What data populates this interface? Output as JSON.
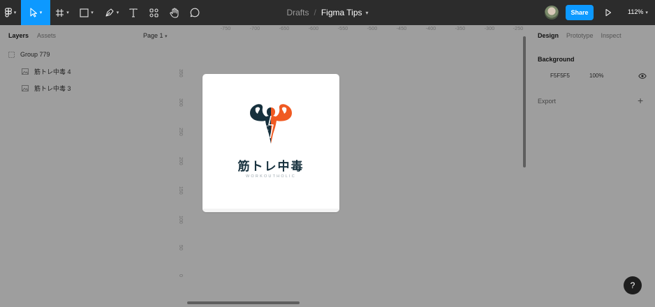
{
  "toolbar": {
    "breadcrumb_folder": "Drafts",
    "breadcrumb_separator": "/",
    "file_name": "Figma Tips",
    "share_label": "Share",
    "zoom_level": "112%"
  },
  "left_panel": {
    "tab_layers": "Layers",
    "tab_assets": "Assets",
    "page_selector": "Page 1",
    "layers": [
      {
        "name": "Group 779"
      },
      {
        "name": "筋トレ中毒 4"
      },
      {
        "name": "筋トレ中毒 3"
      }
    ]
  },
  "canvas": {
    "ruler_top": [
      "-750",
      "-700",
      "-650",
      "-600",
      "-550",
      "-500",
      "-450",
      "-400",
      "-350",
      "-300",
      "-250"
    ],
    "ruler_left": [
      "350",
      "300",
      "250",
      "200",
      "150",
      "100",
      "50",
      "0"
    ],
    "frame": {
      "title": "筋トレ中毒",
      "subtitle": "WORKOUTHOLIC",
      "colors": {
        "navy": "#16303d",
        "orange": "#f05a22"
      }
    }
  },
  "right_panel": {
    "tab_design": "Design",
    "tab_prototype": "Prototype",
    "tab_inspect": "Inspect",
    "background_title": "Background",
    "background_hex": "F5F5F5",
    "background_opacity": "100%",
    "export_label": "Export",
    "export_add": "+"
  },
  "help_label": "?",
  "colors": {
    "toolbar": "#2c2c2c",
    "accent": "#0d99ff",
    "canvas": "#9e9e9e"
  }
}
